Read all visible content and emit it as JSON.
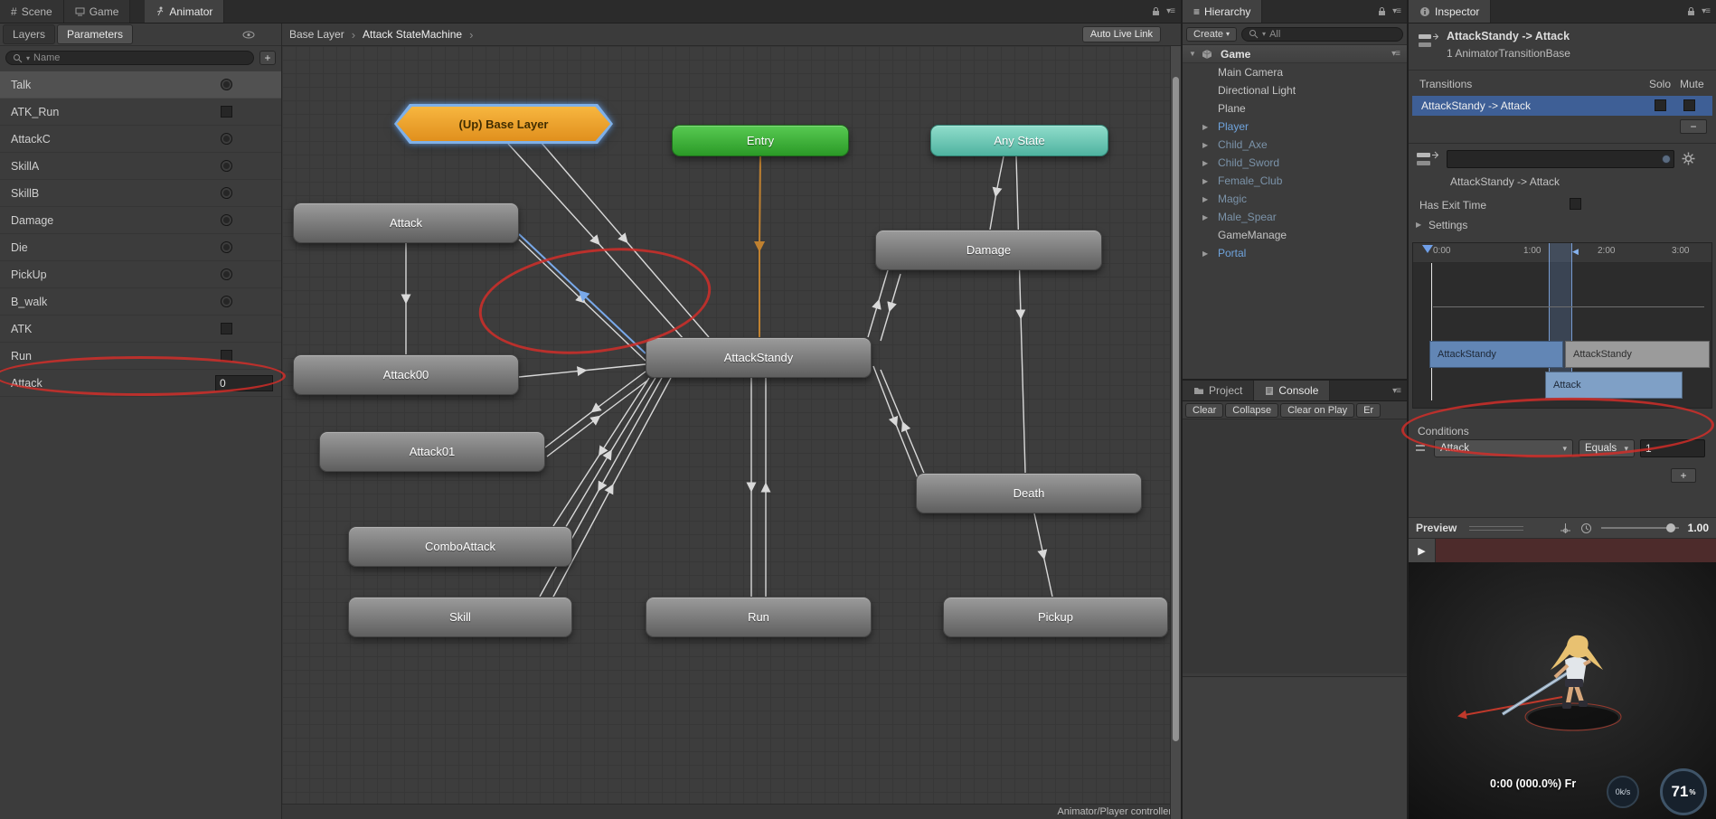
{
  "icons": {
    "caret_down": "▾",
    "triangle_right": "▶",
    "triangle_down": "▼",
    "menu": "≡",
    "plus": "+",
    "minus": "−",
    "play": "▶",
    "crumb_sep": "›",
    "left_marker": "◀",
    "hash": "#"
  },
  "top_tabs": {
    "scene": "Scene",
    "game": "Game",
    "animator": "Animator"
  },
  "parameters_panel": {
    "layers_tab": "Layers",
    "parameters_tab": "Parameters",
    "search_placeholder": "Name",
    "items": [
      {
        "name": "Talk"
      },
      {
        "name": "ATK_Run"
      },
      {
        "name": "AttackC"
      },
      {
        "name": "SkillA"
      },
      {
        "name": "SkillB"
      },
      {
        "name": "Damage"
      },
      {
        "name": "Die"
      },
      {
        "name": "PickUp"
      },
      {
        "name": "B_walk"
      },
      {
        "name": "ATK"
      },
      {
        "name": "Run"
      },
      {
        "name": "Attack",
        "value": "0"
      }
    ]
  },
  "graph": {
    "breadcrumbs": [
      "Base Layer",
      "Attack StateMachine"
    ],
    "auto_live_link": "Auto Live Link",
    "nodes": {
      "up_base_layer": "(Up) Base Layer",
      "entry": "Entry",
      "any_state": "Any State",
      "attack": "Attack",
      "damage": "Damage",
      "attack00": "Attack00",
      "attack_standy": "AttackStandy",
      "attack01": "Attack01",
      "combo_attack": "ComboAttack",
      "death": "Death",
      "skill": "Skill",
      "run": "Run",
      "pickup": "Pickup"
    },
    "footer": "Animator/Player controller"
  },
  "hierarchy": {
    "tab": "Hierarchy",
    "create_button": "Create",
    "search_text": "All",
    "scene_name": "Game",
    "items": [
      {
        "label": "Main Camera"
      },
      {
        "label": "Directional Light"
      },
      {
        "label": "Plane"
      },
      {
        "label": "Player"
      },
      {
        "label": "Child_Axe"
      },
      {
        "label": "Child_Sword"
      },
      {
        "label": "Female_Club"
      },
      {
        "label": "Magic"
      },
      {
        "label": "Male_Spear"
      },
      {
        "label": "GameManage"
      },
      {
        "label": "Portal"
      }
    ]
  },
  "console": {
    "project_tab": "Project",
    "console_tab": "Console",
    "buttons": [
      "Clear",
      "Collapse",
      "Clear on Play",
      "Er"
    ]
  },
  "inspector": {
    "tab": "Inspector",
    "title": "AttackStandy -> Attack",
    "subtitle": "1 AnimatorTransitionBase",
    "transitions_label": "Transitions",
    "solo_label": "Solo",
    "mute_label": "Mute",
    "transition_row": "AttackStandy -> Attack",
    "transition_name": "AttackStandy -> Attack",
    "has_exit_time": "Has Exit Time",
    "settings_label": "Settings",
    "timeline": {
      "ticks": [
        "0:00",
        "1:00",
        "2:00",
        "3:00"
      ],
      "bar1": "AttackStandy",
      "bar2": "AttackStandy",
      "bar3": "Attack"
    },
    "conditions": {
      "label": "Conditions",
      "param": "Attack",
      "operator": "Equals",
      "value": "1"
    },
    "preview": {
      "label": "Preview",
      "speed": "1.00",
      "status": "0:00 (000.0%) Fr",
      "rate": "0k/s",
      "fps": "71",
      "fps_suffix": "%"
    }
  }
}
